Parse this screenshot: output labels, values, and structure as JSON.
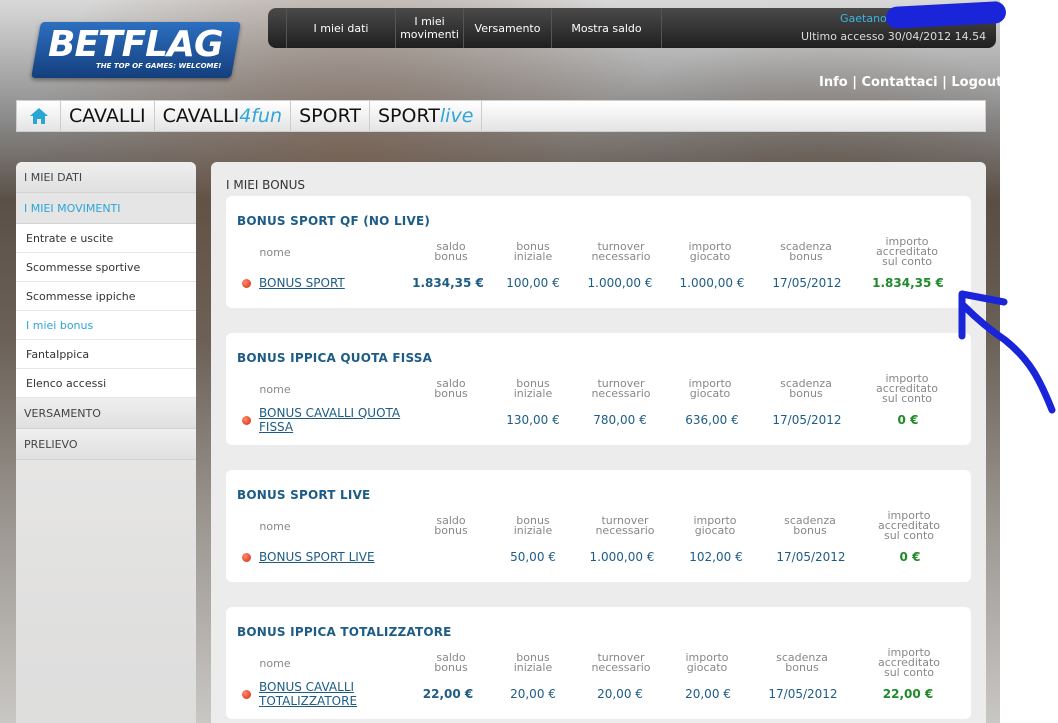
{
  "brand": {
    "logo_text": "BETFLAG",
    "tagline": "THE TOP OF GAMES: WELCOME!"
  },
  "topbar": {
    "items": [
      "I miei dati",
      "I miei movimenti",
      "Versamento",
      "Mostra saldo"
    ],
    "user_name": "Gaetano",
    "last_access": "Ultimo accesso 30/04/2012 14.54"
  },
  "utility": {
    "info": "Info",
    "sep1": " | ",
    "contacts": "Contattaci",
    "sep2": " | ",
    "logout": "Logout"
  },
  "mainnav": {
    "items": [
      {
        "label": "CAVALLI",
        "accent": ""
      },
      {
        "label": "CAVALLI",
        "accent": "4fun"
      },
      {
        "label": "SPORT",
        "accent": ""
      },
      {
        "label": "SPORT",
        "accent": "live"
      }
    ]
  },
  "sidebar": {
    "head_dati": "I MIEI DATI",
    "head_movimenti": "I MIEI MOVIMENTI",
    "sub": [
      "Entrate e uscite",
      "Scommesse sportive",
      "Scommesse ippiche",
      "I miei bonus",
      "FantaIppica",
      "Elenco accessi"
    ],
    "head_versamento": "VERSAMENTO",
    "head_prelievo": "PRELIEVO"
  },
  "content": {
    "title": "I MIEI BONUS",
    "columns": {
      "nome": "nome",
      "saldo_a": "saldo",
      "saldo_b": "bonus",
      "iniziale_a": "bonus",
      "iniziale_b": "iniziale",
      "turnover_a": "turnover",
      "turnover_b": "necessario",
      "importo_a": "importo",
      "importo_b": "giocato",
      "scadenza_a": "scadenza",
      "scadenza_b": "bonus",
      "accreditato_a": "importo",
      "accreditato_b": "accreditato",
      "accreditato_c": "sul conto"
    },
    "panels": [
      {
        "title": "BONUS SPORT QF (NO LIVE)",
        "name_1": "BONUS SPORT",
        "name_2": "",
        "saldo": "1.834,35 €",
        "iniziale": "100,00 €",
        "turnover": "1.000,00 €",
        "giocato": "1.000,00 €",
        "scadenza": "17/05/2012",
        "accreditato": "1.834,35 €"
      },
      {
        "title": "BONUS IPPICA QUOTA FISSA",
        "name_1": "BONUS CAVALLI QUOTA",
        "name_2": "FISSA",
        "saldo": "",
        "iniziale": "130,00 €",
        "turnover": "780,00 €",
        "giocato": "636,00 €",
        "scadenza": "17/05/2012",
        "accreditato": "0 €"
      },
      {
        "title": "BONUS SPORT LIVE",
        "name_1": "BONUS SPORT LIVE",
        "name_2": "",
        "saldo": "",
        "iniziale": "50,00 €",
        "turnover": "1.000,00 €",
        "giocato": "102,00 €",
        "scadenza": "17/05/2012",
        "accreditato": "0 €"
      },
      {
        "title": "BONUS IPPICA TOTALIZZATORE",
        "name_1": "BONUS CAVALLI",
        "name_2": "TOTALIZZATORE",
        "saldo": "22,00 €",
        "iniziale": "20,00 €",
        "turnover": "20,00 €",
        "giocato": "20,00 €",
        "scadenza": "17/05/2012",
        "accreditato": "22,00 €"
      }
    ]
  },
  "colors": {
    "accent": "#2aa5d8",
    "link": "#1d5c86",
    "credit": "#1f8a2a",
    "annotation": "#1a24d8"
  }
}
